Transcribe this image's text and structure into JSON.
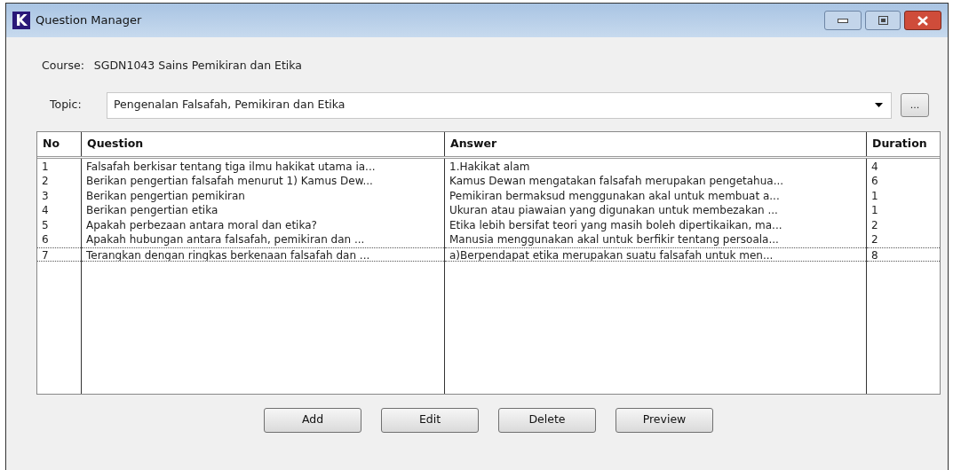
{
  "window": {
    "title": "Question Manager",
    "app_icon": "K"
  },
  "course": {
    "label": "Course:",
    "value": "SGDN1043 Sains Pemikiran dan Etika"
  },
  "topic": {
    "label": "Topic:",
    "value": "Pengenalan Falsafah, Pemikiran dan Etika",
    "browse_button": "..."
  },
  "table": {
    "columns": [
      "No",
      "Question",
      "Answer",
      "Duration"
    ],
    "rows": [
      {
        "cells": [
          "1",
          "Falsafah berkisar tentang tiga ilmu hakikat utama ia...",
          "1.Hakikat alam",
          "4"
        ],
        "selected": false
      },
      {
        "cells": [
          "2",
          "Berikan pengertian falsafah menurut 1) Kamus Dew...",
          "Kamus Dewan mengatakan falsafah merupakan pengetahua...",
          "6"
        ],
        "selected": false
      },
      {
        "cells": [
          "3",
          "Berikan pengertian pemikiran",
          "Pemikiran bermaksud menggunakan akal untuk membuat a...",
          "1"
        ],
        "selected": false
      },
      {
        "cells": [
          "4",
          "Berikan pengertian etika",
          "Ukuran atau piawaian yang digunakan untuk membezakan ...",
          "1"
        ],
        "selected": false
      },
      {
        "cells": [
          "5",
          "Apakah perbezaan antara moral dan etika?",
          "Etika lebih bersifat teori yang masih boleh dipertikaikan, ma...",
          "2"
        ],
        "selected": false
      },
      {
        "cells": [
          "6",
          "Apakah hubungan antara  falsafah, pemikiran dan ...",
          "Manusia menggunakan akal untuk berfikir tentang persoala...",
          "2"
        ],
        "selected": false
      },
      {
        "cells": [
          "7",
          "Terangkan dengan ringkas berkenaan falsafah dan ...",
          "a)Berpendapat etika merupakan suatu falsafah untuk men...",
          "8"
        ],
        "selected": true
      }
    ]
  },
  "buttons": [
    "Add",
    "Edit",
    "Delete",
    "Preview"
  ]
}
